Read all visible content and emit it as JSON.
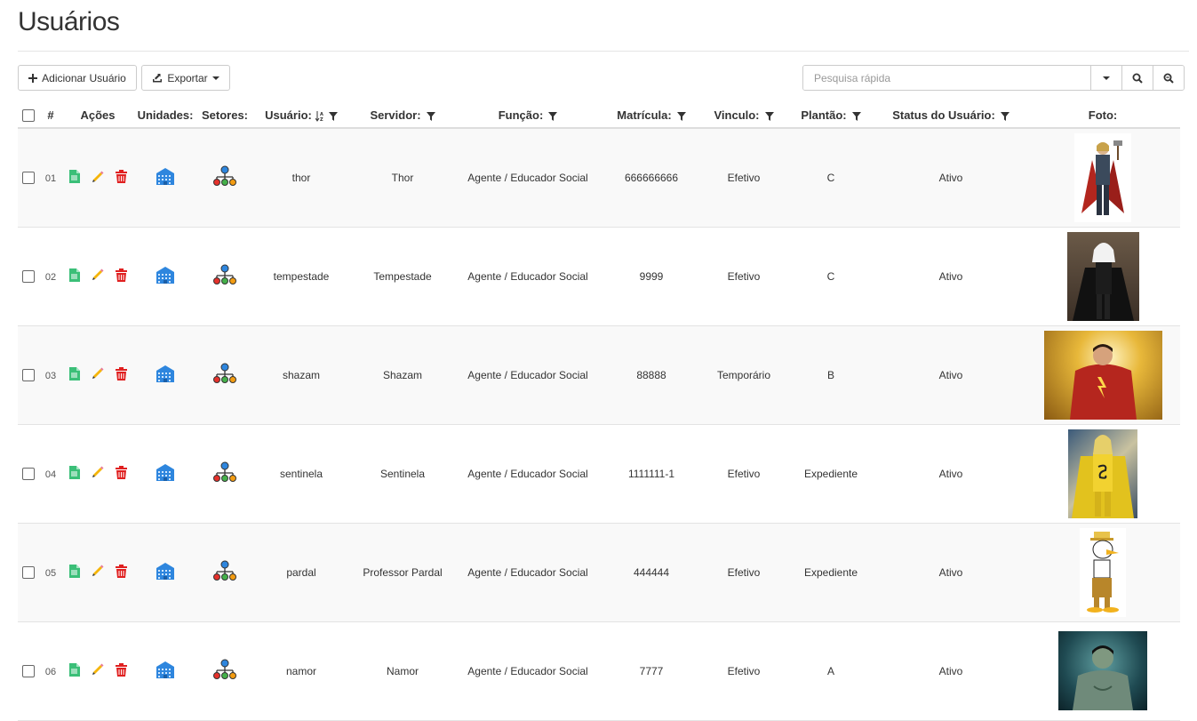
{
  "page": {
    "title": "Usuários"
  },
  "toolbar": {
    "add_label": "Adicionar Usuário",
    "export_label": "Exportar",
    "search_placeholder": "Pesquisa rápida"
  },
  "table": {
    "headers": {
      "num": "#",
      "actions": "Ações",
      "units": "Unidades:",
      "sectors": "Setores:",
      "user": "Usuário:",
      "server": "Servidor:",
      "function": "Função:",
      "registration": "Matrícula:",
      "bond": "Vinculo:",
      "shift": "Plantão:",
      "status": "Status do Usuário:",
      "photo": "Foto:"
    },
    "rows": [
      {
        "num": "01",
        "user": "thor",
        "server": "Thor",
        "function": "Agente / Educador Social",
        "registration": "666666666",
        "bond": "Efetivo",
        "shift": "C",
        "status": "Ativo"
      },
      {
        "num": "02",
        "user": "tempestade",
        "server": "Tempestade",
        "function": "Agente / Educador Social",
        "registration": "9999",
        "bond": "Efetivo",
        "shift": "C",
        "status": "Ativo"
      },
      {
        "num": "03",
        "user": "shazam",
        "server": "Shazam",
        "function": "Agente / Educador Social",
        "registration": "88888",
        "bond": "Temporário",
        "shift": "B",
        "status": "Ativo"
      },
      {
        "num": "04",
        "user": "sentinela",
        "server": "Sentinela",
        "function": "Agente / Educador Social",
        "registration": "1111111-1",
        "bond": "Efetivo",
        "shift": "Expediente",
        "status": "Ativo"
      },
      {
        "num": "05",
        "user": "pardal",
        "server": "Professor Pardal",
        "function": "Agente / Educador Social",
        "registration": "444444",
        "bond": "Efetivo",
        "shift": "Expediente",
        "status": "Ativo"
      },
      {
        "num": "06",
        "user": "namor",
        "server": "Namor",
        "function": "Agente / Educador Social",
        "registration": "7777",
        "bond": "Efetivo",
        "shift": "A",
        "status": "Ativo"
      }
    ]
  },
  "icons": {
    "add": "plus-icon",
    "export": "export-icon",
    "search": "search-icon",
    "zoom": "zoom-icon",
    "view": "document-icon",
    "edit": "pencil-icon",
    "delete": "trash-icon",
    "units": "building-icon",
    "sectors": "org-chart-icon",
    "filter": "filter-icon",
    "sort": "sort-alpha-icon"
  },
  "colors": {
    "view": "#3bbf78",
    "edit": "#f5b50a",
    "delete": "#e02020",
    "building": "#2e86de",
    "org_top": "#2e86de",
    "org_left": "#e5312b",
    "org_mid": "#44b04a",
    "org_right": "#f39c12"
  }
}
